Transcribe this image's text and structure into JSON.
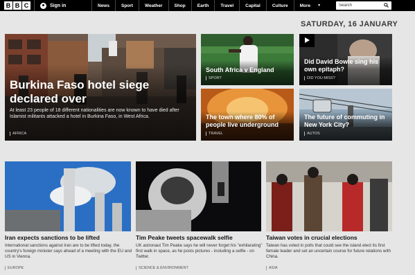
{
  "header": {
    "logo_letters": [
      "B",
      "B",
      "C"
    ],
    "sign_in": "Sign in",
    "nav": [
      "News",
      "Sport",
      "Weather",
      "Shop",
      "Earth",
      "Travel",
      "Capital",
      "Culture",
      "More"
    ],
    "search_placeholder": "Search"
  },
  "date": "SATURDAY, 16 JANUARY",
  "hero": {
    "title": "Burkina Faso hotel siege declared over",
    "summary": "At least 23 people of 18 different nationalities are now known to have died after Islamist militants attacked a hotel in Burkina Faso, in West Africa.",
    "tag": "AFRICA"
  },
  "cards": [
    {
      "title": "South Africa v England",
      "tag": "SPORT"
    },
    {
      "title": "Did David Bowie sing his own epitaph?",
      "tag": "DID YOU MISS?"
    },
    {
      "title": "The town where 80% of people live underground",
      "tag": "TRAVEL"
    },
    {
      "title": "The future of commuting in New York City?",
      "tag": "AUTOS"
    }
  ],
  "bottom_stories": [
    {
      "title": "Iran expects sanctions to be lifted",
      "summary": "International sanctions against Iran are to be lifted today, the country's foreign minister says ahead of a meeting with the EU and US in Vienna.",
      "tag": "EUROPE"
    },
    {
      "title": "Tim Peake tweets spacewalk selfie",
      "summary": "UK astronaut Tim Peake says he will never forget his \"exhilarating\" first walk in space, as he posts pictures - including a selfie - on Twitter.",
      "tag": "SCIENCE & ENVIRONMENT"
    },
    {
      "title": "Taiwan votes in crucial elections",
      "summary": "Taiwan has voted in polls that could see the island elect its first female leader and set an uncertain course for future relations with China.",
      "tag": "ASIA"
    }
  ]
}
